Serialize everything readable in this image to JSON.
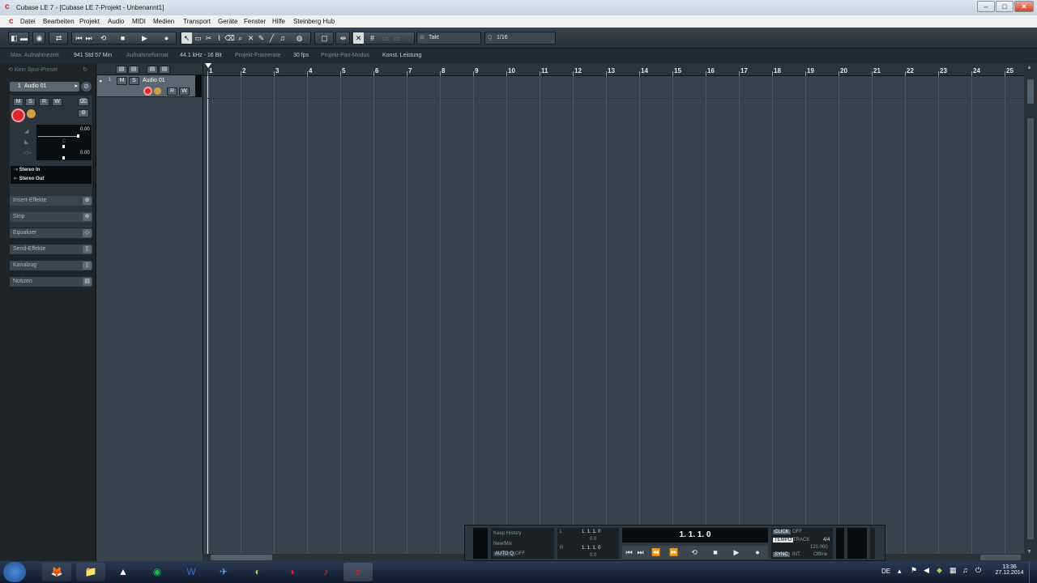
{
  "window": {
    "title": "Cubase LE 7 - [Cubase LE 7-Projekt - Unbenannt1]",
    "controls": [
      "–",
      "□",
      "✕"
    ]
  },
  "menu": [
    "Datei",
    "Bearbeiten",
    "Projekt",
    "Audio",
    "MIDI",
    "Medien",
    "Transport",
    "Geräte",
    "Fenster",
    "Hilfe",
    "Steinberg Hub"
  ],
  "toolbar": {
    "snap_type": "Takt",
    "quantize": "1/16"
  },
  "status": {
    "rec_time_label": "Max. Aufnahmezeit",
    "rec_time_value": "941 Std 57 Min",
    "format_label": "Aufnahmeformat",
    "format_value": "44.1 kHz - 16 Bit",
    "framerate_label": "Projekt-Framerate",
    "framerate_value": "30 fps",
    "pan_label": "Projekt-Pan-Modus",
    "pan_value": "Konst. Leistung"
  },
  "inspector": {
    "preset": "Kein Spur-Preset",
    "track_number": "1",
    "track_name": "Audio 01",
    "volume": "0.00",
    "pan": "C",
    "pan_value": "0.00",
    "input": "Stereo In",
    "output": "Stereo Out",
    "sections": [
      "Insert-Effekte",
      "Strip",
      "Equalizer",
      "Send-Effekte",
      "Kanalzug",
      "Notizen"
    ]
  },
  "track": {
    "number": "1",
    "name": "Audio 01",
    "m": "M",
    "s": "S",
    "r": "R",
    "w": "W"
  },
  "ruler": [
    "1",
    "2",
    "3",
    "4",
    "5",
    "6",
    "7",
    "8",
    "9",
    "10",
    "11",
    "12",
    "13",
    "14",
    "15",
    "16",
    "17",
    "18",
    "19",
    "20",
    "21",
    "22",
    "23",
    "24",
    "25"
  ],
  "transport": {
    "history1": "Keep History",
    "history2": "New/Mix",
    "auto_q": "AUTO Q",
    "auto_q_state": "OFF",
    "left_locator": "1. 1. 1.   0",
    "left_sub": "0   0",
    "right_locator": "1. 1. 1.   0",
    "right_sub": "0   0",
    "position": "1.  1.  1.    0",
    "click_label": "CLICK",
    "click_state": "OFF",
    "tempo_label": "TEMPO",
    "tempo_mode": "TRACK",
    "signature": "4/4",
    "tempo_value": "120.000",
    "sync_label": "SYNC",
    "sync_mode": "INT.",
    "sync_state": "Offline"
  },
  "taskbar": {
    "lang": "DE",
    "time": "13:36",
    "date": "27.12.2014"
  },
  "colors": {
    "accent_record": "#d9272e",
    "background": "#37434d"
  }
}
